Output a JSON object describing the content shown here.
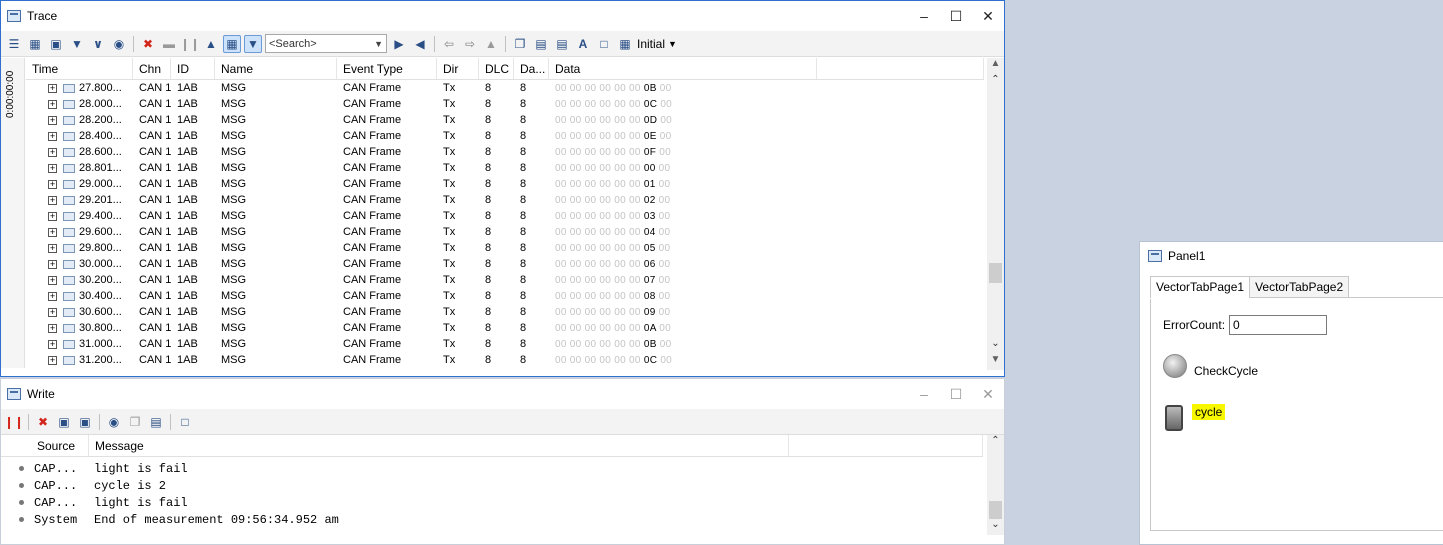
{
  "trace": {
    "title": "Trace",
    "search_placeholder": "<Search>",
    "initial_label": "Initial",
    "time_ruler": "0:00:00:00",
    "columns": [
      "Time",
      "Chn",
      "ID",
      "Name",
      "Event Type",
      "Dir",
      "DLC",
      "Da...",
      "Data"
    ],
    "rows": [
      {
        "time": "27.800...",
        "chn": "CAN 1",
        "id": "1AB",
        "name": "MSG",
        "event": "CAN Frame",
        "dir": "Tx",
        "dlc": "8",
        "da": "8",
        "pre": "00 00 00 00 00 00",
        "hi": "0B",
        "post": "00"
      },
      {
        "time": "28.000...",
        "chn": "CAN 1",
        "id": "1AB",
        "name": "MSG",
        "event": "CAN Frame",
        "dir": "Tx",
        "dlc": "8",
        "da": "8",
        "pre": "00 00 00 00 00 00",
        "hi": "0C",
        "post": "00"
      },
      {
        "time": "28.200...",
        "chn": "CAN 1",
        "id": "1AB",
        "name": "MSG",
        "event": "CAN Frame",
        "dir": "Tx",
        "dlc": "8",
        "da": "8",
        "pre": "00 00 00 00 00 00",
        "hi": "0D",
        "post": "00"
      },
      {
        "time": "28.400...",
        "chn": "CAN 1",
        "id": "1AB",
        "name": "MSG",
        "event": "CAN Frame",
        "dir": "Tx",
        "dlc": "8",
        "da": "8",
        "pre": "00 00 00 00 00 00",
        "hi": "0E",
        "post": "00"
      },
      {
        "time": "28.600...",
        "chn": "CAN 1",
        "id": "1AB",
        "name": "MSG",
        "event": "CAN Frame",
        "dir": "Tx",
        "dlc": "8",
        "da": "8",
        "pre": "00 00 00 00 00 00",
        "hi": "0F",
        "post": "00"
      },
      {
        "time": "28.801...",
        "chn": "CAN 1",
        "id": "1AB",
        "name": "MSG",
        "event": "CAN Frame",
        "dir": "Tx",
        "dlc": "8",
        "da": "8",
        "pre": "00 00 00 00 00 00",
        "hi": "00",
        "post": "00"
      },
      {
        "time": "29.000...",
        "chn": "CAN 1",
        "id": "1AB",
        "name": "MSG",
        "event": "CAN Frame",
        "dir": "Tx",
        "dlc": "8",
        "da": "8",
        "pre": "00 00 00 00 00 00",
        "hi": "01",
        "post": "00"
      },
      {
        "time": "29.201...",
        "chn": "CAN 1",
        "id": "1AB",
        "name": "MSG",
        "event": "CAN Frame",
        "dir": "Tx",
        "dlc": "8",
        "da": "8",
        "pre": "00 00 00 00 00 00",
        "hi": "02",
        "post": "00"
      },
      {
        "time": "29.400...",
        "chn": "CAN 1",
        "id": "1AB",
        "name": "MSG",
        "event": "CAN Frame",
        "dir": "Tx",
        "dlc": "8",
        "da": "8",
        "pre": "00 00 00 00 00 00",
        "hi": "03",
        "post": "00"
      },
      {
        "time": "29.600...",
        "chn": "CAN 1",
        "id": "1AB",
        "name": "MSG",
        "event": "CAN Frame",
        "dir": "Tx",
        "dlc": "8",
        "da": "8",
        "pre": "00 00 00 00 00 00",
        "hi": "04",
        "post": "00"
      },
      {
        "time": "29.800...",
        "chn": "CAN 1",
        "id": "1AB",
        "name": "MSG",
        "event": "CAN Frame",
        "dir": "Tx",
        "dlc": "8",
        "da": "8",
        "pre": "00 00 00 00 00 00",
        "hi": "05",
        "post": "00"
      },
      {
        "time": "30.000...",
        "chn": "CAN 1",
        "id": "1AB",
        "name": "MSG",
        "event": "CAN Frame",
        "dir": "Tx",
        "dlc": "8",
        "da": "8",
        "pre": "00 00 00 00 00 00",
        "hi": "06",
        "post": "00"
      },
      {
        "time": "30.200...",
        "chn": "CAN 1",
        "id": "1AB",
        "name": "MSG",
        "event": "CAN Frame",
        "dir": "Tx",
        "dlc": "8",
        "da": "8",
        "pre": "00 00 00 00 00 00",
        "hi": "07",
        "post": "00"
      },
      {
        "time": "30.400...",
        "chn": "CAN 1",
        "id": "1AB",
        "name": "MSG",
        "event": "CAN Frame",
        "dir": "Tx",
        "dlc": "8",
        "da": "8",
        "pre": "00 00 00 00 00 00",
        "hi": "08",
        "post": "00"
      },
      {
        "time": "30.600...",
        "chn": "CAN 1",
        "id": "1AB",
        "name": "MSG",
        "event": "CAN Frame",
        "dir": "Tx",
        "dlc": "8",
        "da": "8",
        "pre": "00 00 00 00 00 00",
        "hi": "09",
        "post": "00"
      },
      {
        "time": "30.800...",
        "chn": "CAN 1",
        "id": "1AB",
        "name": "MSG",
        "event": "CAN Frame",
        "dir": "Tx",
        "dlc": "8",
        "da": "8",
        "pre": "00 00 00 00 00 00",
        "hi": "0A",
        "post": "00"
      },
      {
        "time": "31.000...",
        "chn": "CAN 1",
        "id": "1AB",
        "name": "MSG",
        "event": "CAN Frame",
        "dir": "Tx",
        "dlc": "8",
        "da": "8",
        "pre": "00 00 00 00 00 00",
        "hi": "0B",
        "post": "00"
      },
      {
        "time": "31.200...",
        "chn": "CAN 1",
        "id": "1AB",
        "name": "MSG",
        "event": "CAN Frame",
        "dir": "Tx",
        "dlc": "8",
        "da": "8",
        "pre": "00 00 00 00 00 00",
        "hi": "0C",
        "post": "00"
      }
    ]
  },
  "write": {
    "title": "Write",
    "columns": [
      "Source",
      "Message"
    ],
    "rows": [
      {
        "source": "CAP...",
        "message": "light is fail"
      },
      {
        "source": "CAP...",
        "message": "cycle is 2"
      },
      {
        "source": "CAP...",
        "message": "light is fail"
      },
      {
        "source": "System",
        "message": "End of measurement 09:56:34.952 am"
      }
    ]
  },
  "panel": {
    "title": "Panel1",
    "tabs": [
      "VectorTabPage1",
      "VectorTabPage2"
    ],
    "error_label": "ErrorCount:",
    "error_value": "0",
    "check_label": "CheckCycle",
    "cycle_label": "cycle",
    "highlight_color": "#f7f700"
  }
}
